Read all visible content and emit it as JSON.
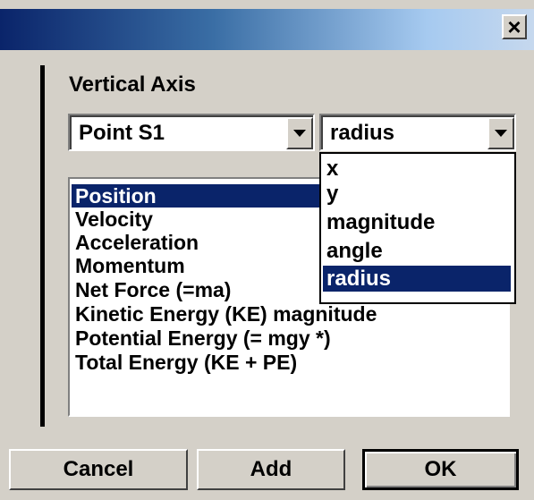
{
  "dialog": {
    "close_glyph": "×"
  },
  "vertical_axis": {
    "label": "Vertical Axis",
    "object_combo": {
      "selected": "Point S1"
    },
    "component_combo": {
      "selected": "radius"
    }
  },
  "quantity_list": {
    "items": [
      {
        "label": "Position",
        "selected": true
      },
      {
        "label": "Velocity",
        "selected": false
      },
      {
        "label": "Acceleration",
        "selected": false
      },
      {
        "label": "Momentum",
        "selected": false
      },
      {
        "label": "Net Force (=ma)",
        "selected": false
      },
      {
        "label": "Kinetic Energy (KE) magnitude",
        "selected": false
      },
      {
        "label": "Potential Energy (= mgy *)",
        "selected": false
      },
      {
        "label": "Total Energy (KE + PE)",
        "selected": false
      }
    ]
  },
  "component_dropdown": {
    "options": [
      {
        "label": "x",
        "selected": false
      },
      {
        "label": "y",
        "selected": false
      },
      {
        "label": "magnitude",
        "selected": false
      },
      {
        "label": "angle",
        "selected": false
      },
      {
        "label": "radius",
        "selected": true
      }
    ]
  },
  "buttons": {
    "cancel": "Cancel",
    "add": "Add",
    "ok": "OK"
  },
  "colors": {
    "selection": "#0a246a",
    "face": "#d4d0c8"
  }
}
